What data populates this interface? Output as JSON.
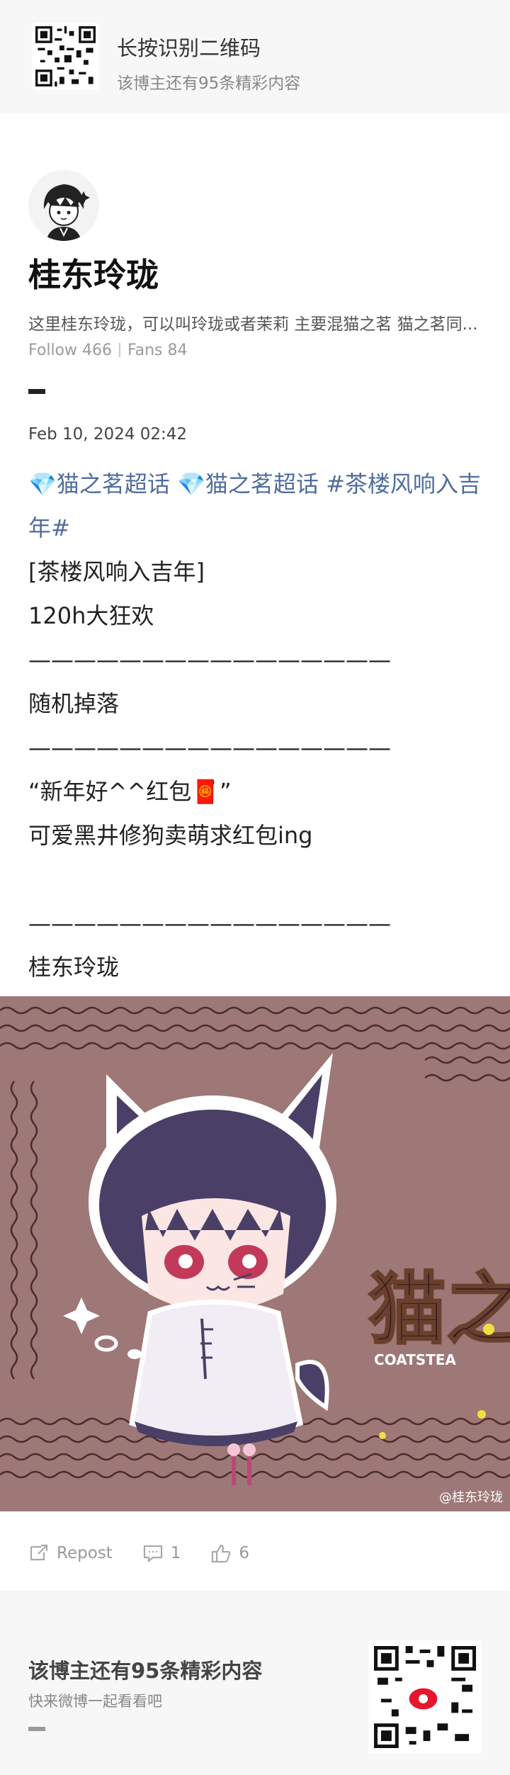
{
  "qr_banner": {
    "title": "长按识别二维码",
    "subtitle": "该博主还有95条精彩内容"
  },
  "profile": {
    "name": "桂东玲珑",
    "bio": "这里桂东玲珑，可以叫玲珑或者茉莉 主要混猫之茗 猫之茗同...",
    "follow_label": "Follow 466",
    "fans_label": "Fans 84"
  },
  "post": {
    "date": "Feb 10, 2024 02:42",
    "tag1": "猫之茗超话",
    "tag2": "猫之茗超话",
    "tag3a": "#茶楼风响入吉",
    "tag3b": "年#",
    "lines": [
      "[茶楼风响入吉年]",
      "120h大狂欢",
      "————————————————",
      "随机掉落",
      "————————————————",
      "“新年好^^红包🧧”",
      "可爱黑井修狗卖萌求红包ing",
      "",
      "————————————————",
      "桂东玲珑"
    ]
  },
  "image": {
    "watermark": "@桂东玲珑",
    "logo_text": "猫之茗",
    "logo_sub": "COATSTEA"
  },
  "actions": {
    "repost": "Repost",
    "comments": "1",
    "likes": "6"
  },
  "footer": {
    "title": "该博主还有95条精彩内容",
    "subtitle": "快来微博一起看看吧"
  },
  "colors": {
    "tag": "#4f6d9e",
    "image_bg": "#9e7777"
  }
}
